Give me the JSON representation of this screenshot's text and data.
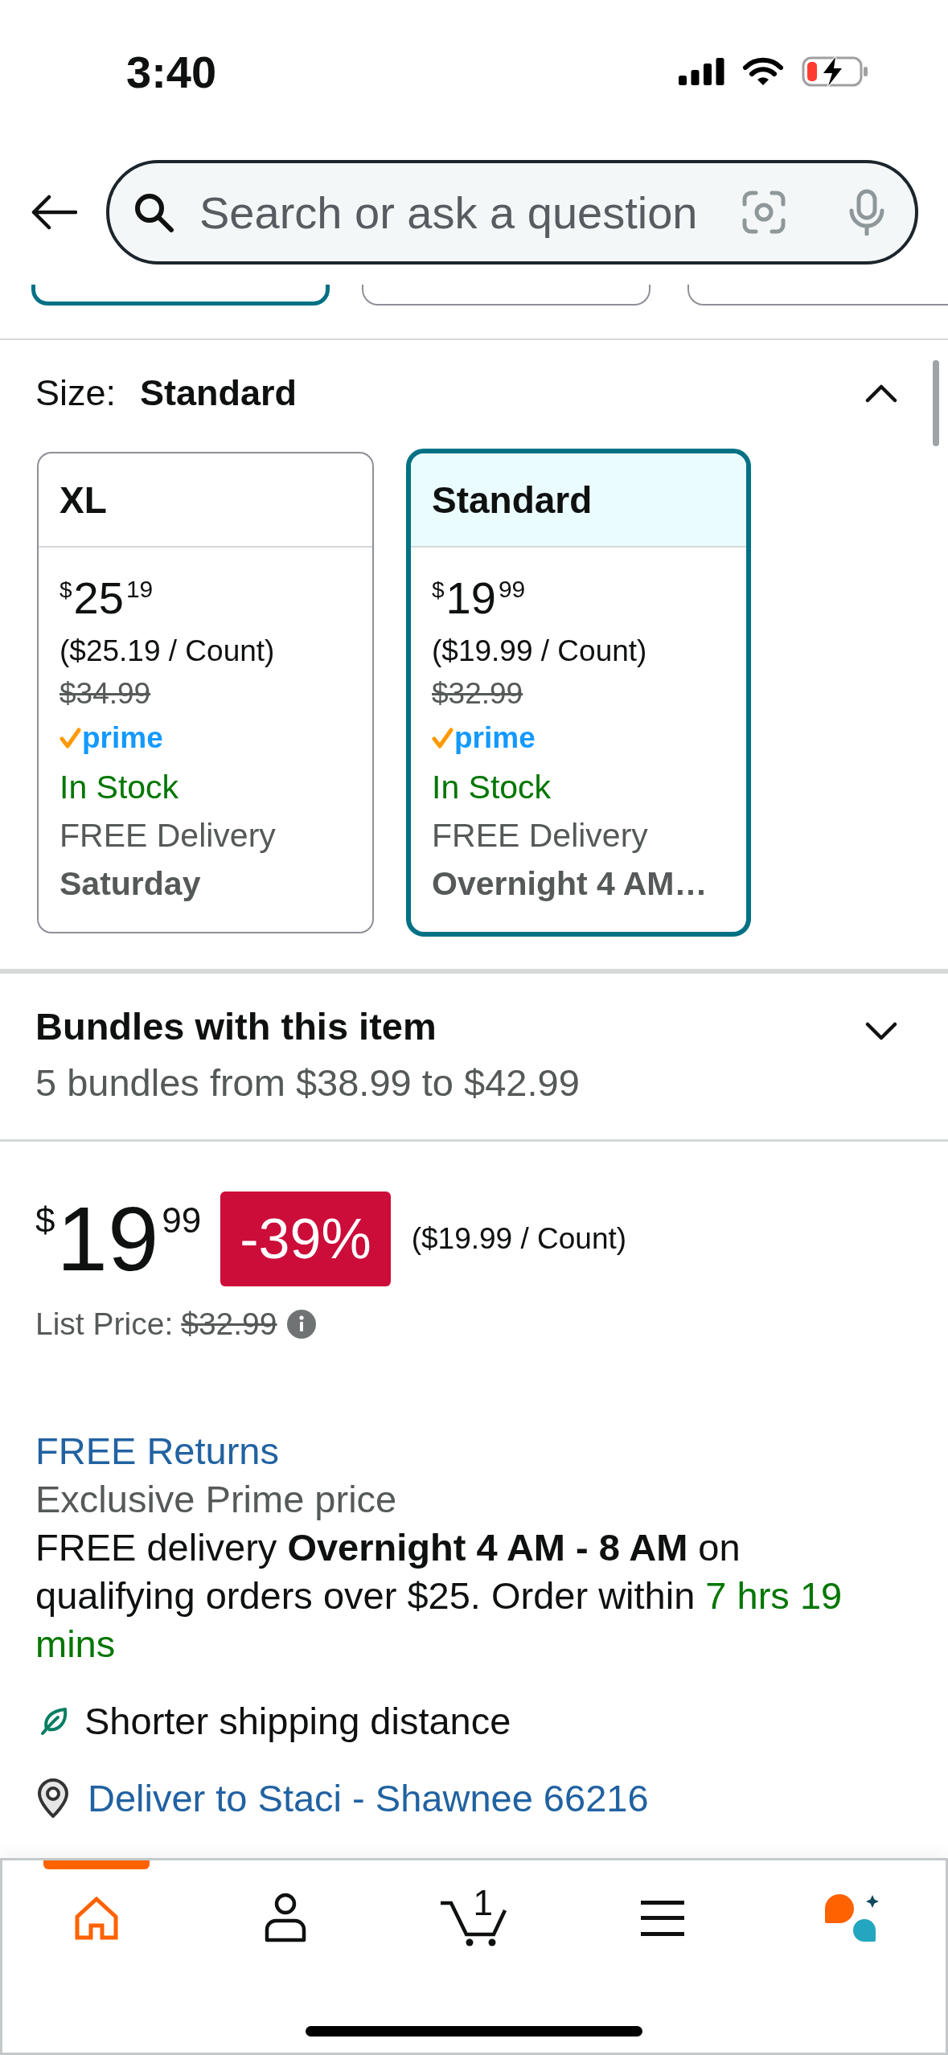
{
  "status_bar": {
    "time": "3:40"
  },
  "search": {
    "placeholder": "Search or ask a question"
  },
  "option_buttons": [
    {
      "selected": true
    },
    {
      "selected": false
    },
    {
      "selected": false
    }
  ],
  "size_selector": {
    "label": "Size:",
    "value": "Standard",
    "expanded": true,
    "options": [
      {
        "label": "XL",
        "selected": false,
        "currency": "$",
        "price_whole": "25",
        "price_fraction": "19",
        "unit_price": "($25.19 / Count)",
        "list_price": "$34.99",
        "prime": "prime",
        "availability": "In Stock",
        "delivery": "FREE Delivery",
        "delivery_date": "Saturday"
      },
      {
        "label": "Standard",
        "selected": true,
        "currency": "$",
        "price_whole": "19",
        "price_fraction": "99",
        "unit_price": "($19.99 / Count)",
        "list_price": "$32.99",
        "prime": "prime",
        "availability": "In Stock",
        "delivery": "FREE Delivery",
        "delivery_date": "Overnight 4 AM…"
      }
    ]
  },
  "bundles": {
    "title": "Bundles with this item",
    "summary": "5 bundles from $38.99 to $42.99",
    "expanded": false
  },
  "price": {
    "currency": "$",
    "whole": "19",
    "fraction": "99",
    "discount": "-39%",
    "unit_price": "($19.99 / Count)",
    "list_price_label": "List Price:",
    "list_price": "$32.99"
  },
  "delivery": {
    "returns_link": "FREE Returns",
    "prime_note": "Exclusive Prime price",
    "message": "FREE delivery **Overnight 4 AM - 8 AM** on qualifying orders over $25. Order within",
    "countdown": "7 hrs 19 mins",
    "sustainability": "Shorter shipping distance",
    "deliver_to": "Deliver to Staci - Shawnee 66216"
  },
  "nav": [
    {
      "kind": "home",
      "selected": true
    },
    {
      "kind": "account",
      "selected": false
    },
    {
      "kind": "cart",
      "selected": false,
      "count": "1"
    },
    {
      "kind": "menu",
      "selected": false
    },
    {
      "kind": "assistant",
      "selected": false
    }
  ]
}
